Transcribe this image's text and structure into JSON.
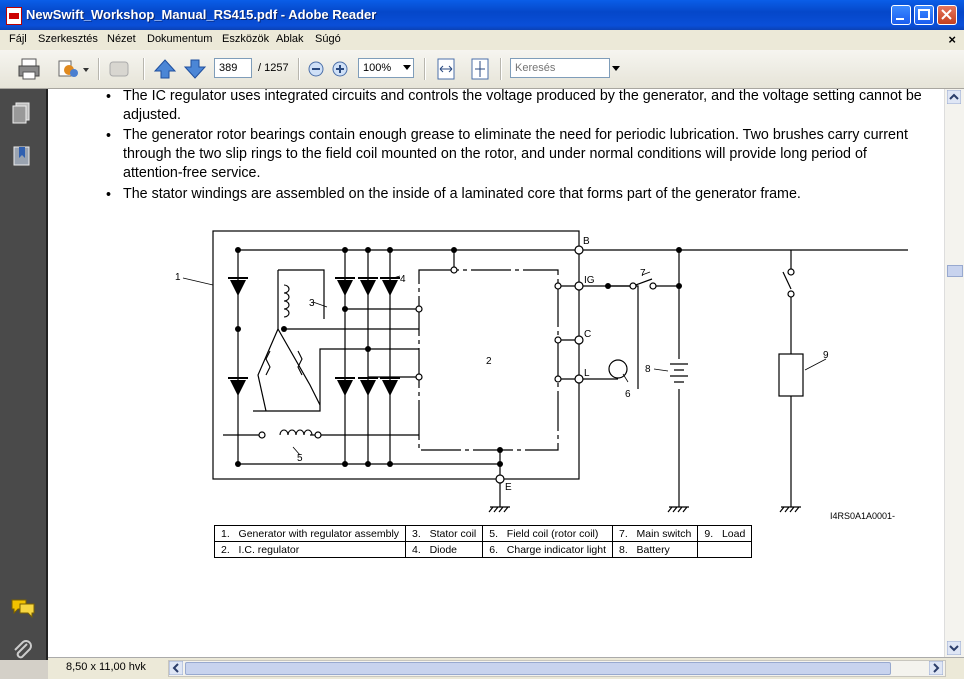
{
  "window": {
    "title": "NewSwift_Workshop_Manual_RS415.pdf - Adobe Reader"
  },
  "menu": [
    "Fájl",
    "Szerkesztés",
    "Nézet",
    "Dokumentum",
    "Eszközök",
    "Ablak",
    "Súgó"
  ],
  "menu_close": "×",
  "toolbar": {
    "page_current": "389",
    "page_total": "/ 1257",
    "zoom": "100%",
    "search_placeholder": "Keresés"
  },
  "document": {
    "bullets": [
      "The IC regulator uses integrated circuits and controls the voltage produced by the generator, and the voltage setting cannot be adjusted.",
      "The generator rotor bearings contain enough grease to eliminate the need for periodic lubrication. Two brushes carry current through the two slip rings to the field coil mounted on the rotor, and under normal conditions will provide long period of attention-free service.",
      "The stator windings are assembled on the inside of a laminated core that forms part of the generator frame."
    ],
    "diagram": {
      "labels": [
        "1",
        "2",
        "3",
        "4",
        "5",
        "6",
        "7",
        "8",
        "9"
      ],
      "terminals": [
        "B",
        "IG",
        "C",
        "L",
        "E"
      ],
      "figure_code": "I4RS0A1A0001-"
    },
    "legend": [
      [
        "1.",
        "Generator with regulator assembly",
        "3.",
        "Stator coil",
        "5.",
        "Field coil (rotor coil)",
        "7.",
        "Main switch",
        "9.",
        "Load"
      ],
      [
        "2.",
        "I.C. regulator",
        "4.",
        "Diode",
        "6.",
        "Charge indicator light",
        "8.",
        "Battery",
        "",
        ""
      ]
    ]
  },
  "status": {
    "page_size": "8,50 x 11,00 hvk"
  }
}
